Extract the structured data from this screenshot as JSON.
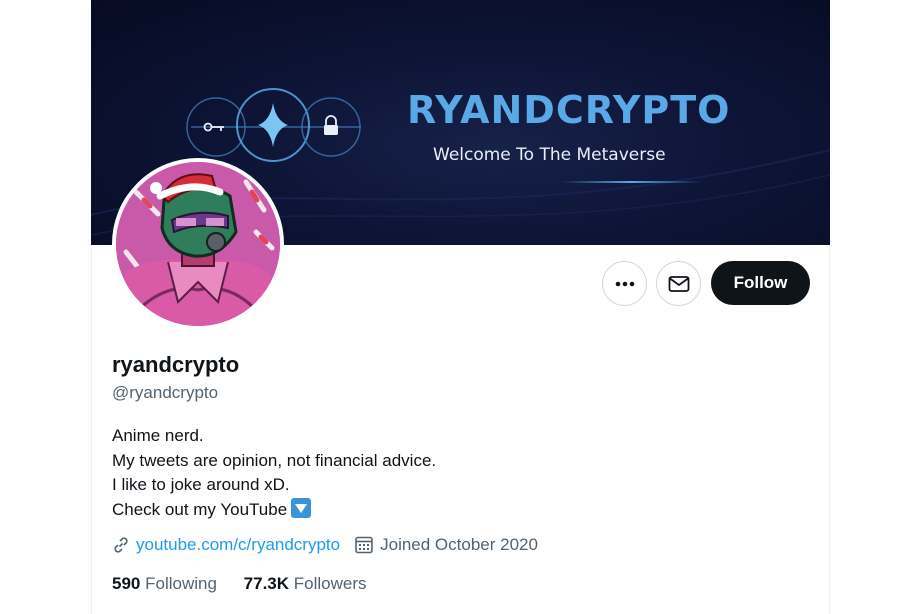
{
  "banner": {
    "title": "RYANDCRYPTO",
    "subtitle": "Welcome To The Metaverse",
    "icons": [
      "key-icon",
      "sparkle-icon",
      "lock-icon"
    ]
  },
  "profile": {
    "display_name": "ryandcrypto",
    "handle": "@ryandcrypto",
    "bio": [
      "Anime nerd.",
      "My tweets are opinion, not financial advice.",
      "I like to joke around xD.",
      "Check out my YouTube"
    ],
    "bio_emoji": "down-arrow-box-icon",
    "website": "youtube.com/c/ryandcrypto",
    "joined": "Joined October 2020",
    "following_count": "590",
    "following_label": "Following",
    "followers_count": "77.3K",
    "followers_label": "Followers"
  },
  "actions": {
    "follow_label": "Follow",
    "more_icon": "more-icon",
    "message_icon": "mail-icon"
  },
  "colors": {
    "banner_bg": "#0d1436",
    "banner_accent": "#5aa8e6",
    "link": "#1d9bf0",
    "follow_bg": "#0f1419",
    "muted": "#536471"
  }
}
